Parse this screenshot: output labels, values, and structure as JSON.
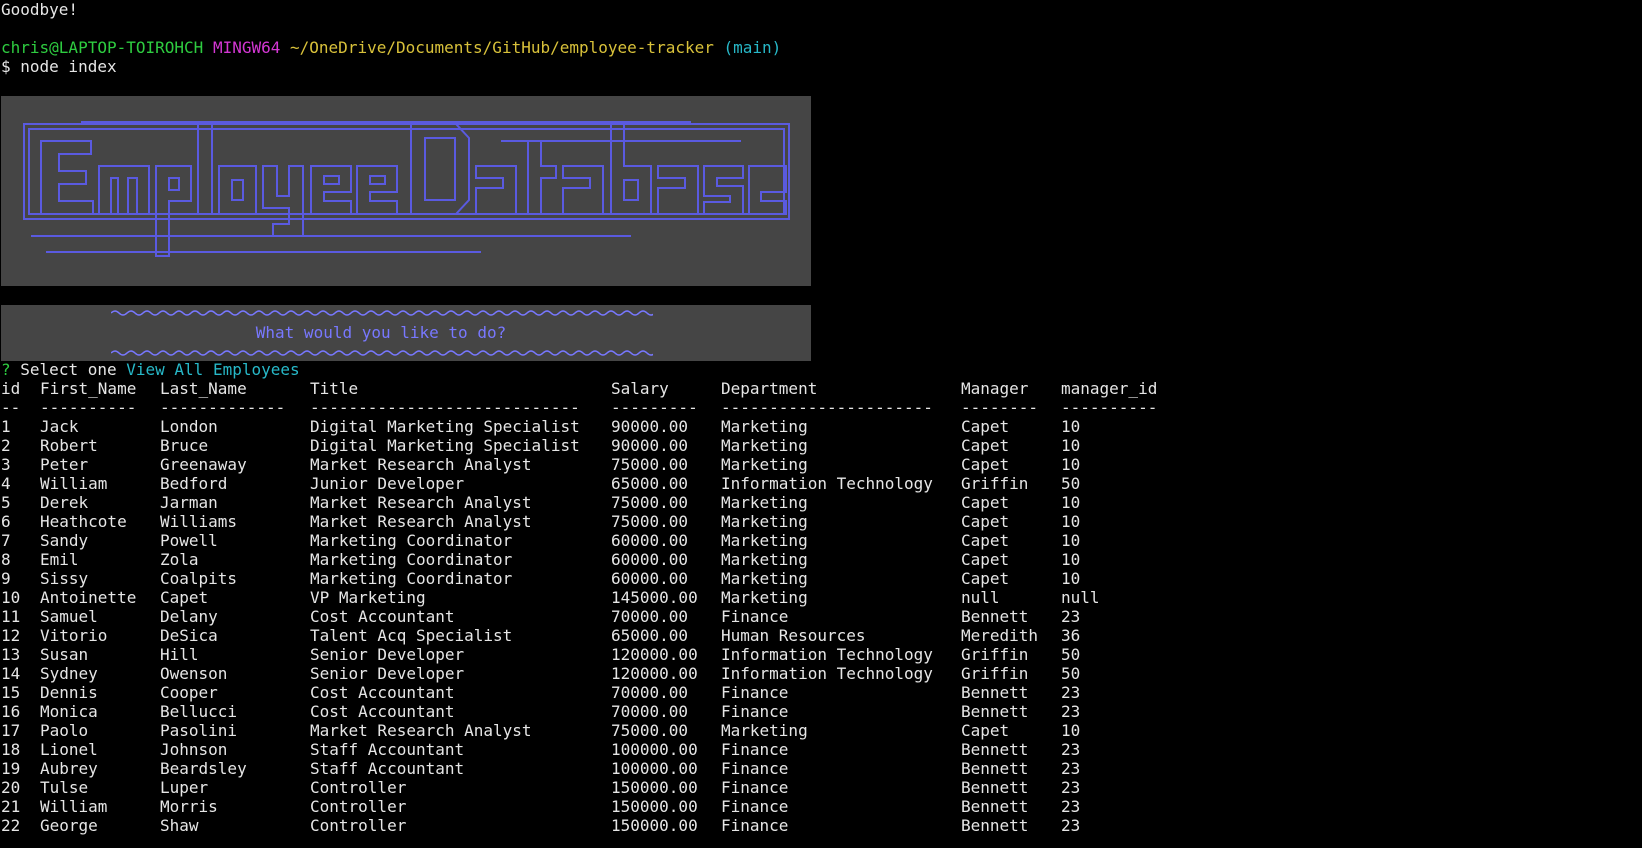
{
  "terminal": {
    "goodbye": "Goodbye!",
    "user_host": "chris@LAPTOP-TOIROHCH",
    "shell": "MINGW64",
    "path": "~/OneDrive/Documents/GitHub/employee-tracker",
    "branch": "(main)",
    "command": "$ node index"
  },
  "banner": {
    "title": "Employee Database",
    "colors": {
      "background": "#454545",
      "stroke": "#5a5ae0",
      "text": "#7878ff"
    }
  },
  "prompt": {
    "question": "What would you like to do?",
    "qmark": "?",
    "label": "Select one",
    "answer": "View All Employees"
  },
  "table": {
    "headers": [
      "id",
      "First_Name",
      "Last_Name",
      "Title",
      "Salary",
      "Department",
      "Manager",
      "manager_id"
    ],
    "separators": [
      "--",
      "----------",
      "-------------",
      "----------------------------",
      "---------",
      "----------------------",
      "--------",
      "----------"
    ],
    "rows": [
      [
        "1",
        "Jack",
        "London",
        "Digital Marketing Specialist",
        "90000.00",
        "Marketing",
        "Capet",
        "10"
      ],
      [
        "2",
        "Robert",
        "Bruce",
        "Digital Marketing Specialist",
        "90000.00",
        "Marketing",
        "Capet",
        "10"
      ],
      [
        "3",
        "Peter",
        "Greenaway",
        "Market Research Analyst",
        "75000.00",
        "Marketing",
        "Capet",
        "10"
      ],
      [
        "4",
        "William",
        "Bedford",
        "Junior Developer",
        "65000.00",
        "Information Technology",
        "Griffin",
        "50"
      ],
      [
        "5",
        "Derek",
        "Jarman",
        "Market Research Analyst",
        "75000.00",
        "Marketing",
        "Capet",
        "10"
      ],
      [
        "6",
        "Heathcote",
        "Williams",
        "Market Research Analyst",
        "75000.00",
        "Marketing",
        "Capet",
        "10"
      ],
      [
        "7",
        "Sandy",
        "Powell",
        "Marketing Coordinator",
        "60000.00",
        "Marketing",
        "Capet",
        "10"
      ],
      [
        "8",
        "Emil",
        "Zola",
        "Marketing Coordinator",
        "60000.00",
        "Marketing",
        "Capet",
        "10"
      ],
      [
        "9",
        "Sissy",
        "Coalpits",
        "Marketing Coordinator",
        "60000.00",
        "Marketing",
        "Capet",
        "10"
      ],
      [
        "10",
        "Antoinette",
        "Capet",
        "VP Marketing",
        "145000.00",
        "Marketing",
        "null",
        "null"
      ],
      [
        "11",
        "Samuel",
        "Delany",
        "Cost Accountant",
        "70000.00",
        "Finance",
        "Bennett",
        "23"
      ],
      [
        "12",
        "Vitorio",
        "DeSica",
        "Talent Acq Specialist",
        "65000.00",
        "Human Resources",
        "Meredith",
        "36"
      ],
      [
        "13",
        "Susan",
        "Hill",
        "Senior Developer",
        "120000.00",
        "Information Technology",
        "Griffin",
        "50"
      ],
      [
        "14",
        "Sydney",
        "Owenson",
        "Senior Developer",
        "120000.00",
        "Information Technology",
        "Griffin",
        "50"
      ],
      [
        "15",
        "Dennis",
        "Cooper",
        "Cost Accountant",
        "70000.00",
        "Finance",
        "Bennett",
        "23"
      ],
      [
        "16",
        "Monica",
        "Bellucci",
        "Cost Accountant",
        "70000.00",
        "Finance",
        "Bennett",
        "23"
      ],
      [
        "17",
        "Paolo",
        "Pasolini",
        "Market Research Analyst",
        "75000.00",
        "Marketing",
        "Capet",
        "10"
      ],
      [
        "18",
        "Lionel",
        "Johnson",
        "Staff Accountant",
        "100000.00",
        "Finance",
        "Bennett",
        "23"
      ],
      [
        "19",
        "Aubrey",
        "Beardsley",
        "Staff Accountant",
        "100000.00",
        "Finance",
        "Bennett",
        "23"
      ],
      [
        "20",
        "Tulse",
        "Luper",
        "Controller",
        "150000.00",
        "Finance",
        "Bennett",
        "23"
      ],
      [
        "21",
        "William",
        "Morris",
        "Controller",
        "150000.00",
        "Finance",
        "Bennett",
        "23"
      ],
      [
        "22",
        "George",
        "Shaw",
        "Controller",
        "150000.00",
        "Finance",
        "Bennett",
        "23"
      ]
    ]
  }
}
